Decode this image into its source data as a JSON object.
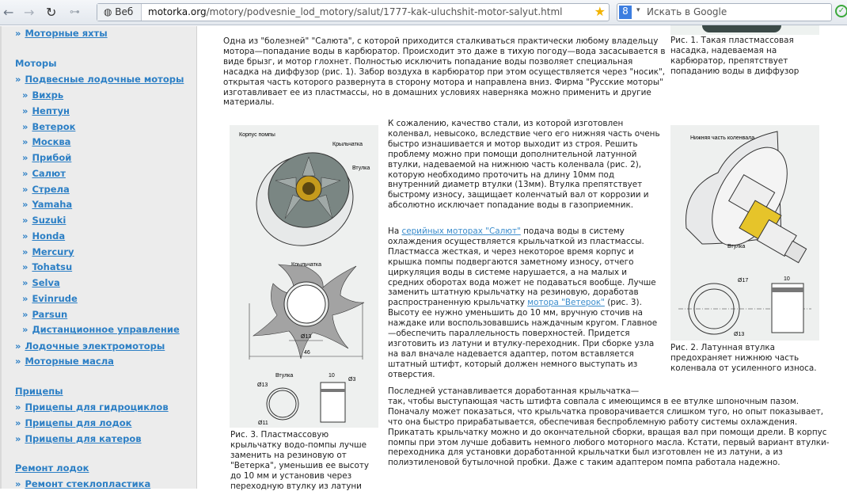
{
  "browser": {
    "web_button": "Веб",
    "url_domain": "motorka.org",
    "url_path": "/motory/podvesnie_lod_motory/salut/1777-kak-uluchshit-motor-salyut.html",
    "search_placeholder": "Искать в Google"
  },
  "sidebar": {
    "top_link": "Моторные яхты",
    "sec_motors": "Моторы",
    "outboard": "Подвесные лодочные моторы",
    "brands": [
      "Вихрь",
      "Нептун",
      "Ветерок",
      "Москва",
      "Прибой",
      "Салют",
      "Стрела",
      "Yamaha",
      "Suzuki",
      "Honda",
      "Mercury",
      "Tohatsu",
      "Selva",
      "Evinrude",
      "Parsun",
      "Дистанционное управление"
    ],
    "electro": "Лодочные электромоторы",
    "oils": "Моторные масла",
    "sec_trailers": "Прицепы",
    "trailers": [
      "Прицепы для гидроциклов",
      "Прицепы для лодок",
      "Прицепы для катеров"
    ],
    "sec_repair": "Ремонт лодок",
    "repair": [
      "Ремонт стеклопластика"
    ]
  },
  "article": {
    "p1": "Одна из \"болезней\" \"Салюта\", с которой приходится сталкиваться практически любому владельцу мотора—попадание воды в карбюратор. Происходит это даже в тихую погоду—вода засасывается в виде брызг, и мотор глохнет. Полностью исключить попадание воды позволяет специальная насадка на диффузор (рис. 1). Забор воздуха в карбюратор при этом осуществляется через \"носик\", открытая часть которого развернута в сторону мотора и направлена вниз. Фирма \"Русские моторы\" изготавливает ее из пластмассы, но в домашних условиях наверняка можно применить и другие материалы.",
    "fig1_caption": "Рис. 1. Такая пластмассовая насадка, надеваемая на карбюратор, препятствует попаданию воды в диффузор",
    "p2": "К сожалению, качество стали, из которой изготовлен коленвал, невысоко, вследствие чего его нижняя часть очень быстро изнашивается и мотор выходит из строя. Решить проблему можно при помощи дополнительной латунной втулки, надеваемой на нижнюю часть коленвала (рис. 2), которую необходимо проточить на длину 10мм под внутренний диаметр втулки (13мм). Втулка препятствует быстрому износу, защищает коленчатый вал от коррозии и абсолютно исключает попадание воды в газоприемник.",
    "p3_pre": "На ",
    "p3_link1": "серийных моторах \"Салют\"",
    "p3_mid": " подача воды в систему охлаждения осуществляется крыльчаткой из пластмассы. Пластмасса жесткая, и через некоторое время корпус и крышка помпы подвергаются заметному износу, отчего циркуляция воды в системе нарушается, а на малых и средних оборотах вода может не подаваться вообще. Лучше заменить штатную крыльчатку на резиновую, доработав распространенную крыльчатку ",
    "p3_link2": "мотора \"Ветерок\"",
    "p3_post": " (рис. 3). Высоту ее нужно уменьшить до 10 мм, вручную сточив на наждаке или воспользовавшись наждачным кругом. Главное—обеспечить параллельность поверхностей. Придется изготовить из латуни и втулку-переходник. При сборке узла на вал вначале надевается адаптер, потом вставляется штатный штифт, который должен немного выступать из отверстия.",
    "p4_first": "Последней устанавливается доработанная крыльчатка—",
    "p4": "так, чтобы выступающая часть штифта совпала с имеющимся в ее втулке шпоночным пазом. Поначалу может показаться, что крыльчатка проворачивается слишком туго, но опыт показывает, что она быстро прирабатывается, обеспечивая беспроблемную работу системы охлаждения. Прикатать крыльчатку можно и до окончательной сборки, вращая вал при помощи дрели. В корпус помпы при этом лучше добавить немного любого моторного масла. Кстати, первый вариант втулки-переходника для установки доработанной крыльчатки был изготовлен не из латуни, а из полиэтиленовой бутылочной пробки. Даже с таким адаптером помпа работала надежно.",
    "fig2_caption": "Рис. 2. Латунная втулка предохраняет нижнюю часть коленвала от усиленного износа.",
    "fig2_labels": {
      "part": "Нижняя часть коленвала",
      "bush": "Втулка",
      "d17": "Ø17",
      "d13": "Ø13",
      "len": "10"
    },
    "fig3_caption": "Рис. 3. Пластмассовую крыльчатку водо-помпы лучше заменить на резиновую от \"Ветерка\", уменьшив ее высоту до 10 мм и установив через переходную втулку из латуни",
    "fig3_labels": {
      "housing": "Корпус помпы",
      "impeller": "Крыльчатка",
      "bush": "Втулка",
      "impeller2": "Крыльчатка",
      "d13": "Ø13",
      "width": "46",
      "bush2": "Втулка",
      "bd13": "Ø13",
      "bd11": "Ø11",
      "blen": "10",
      "d3": "Ø3"
    }
  }
}
